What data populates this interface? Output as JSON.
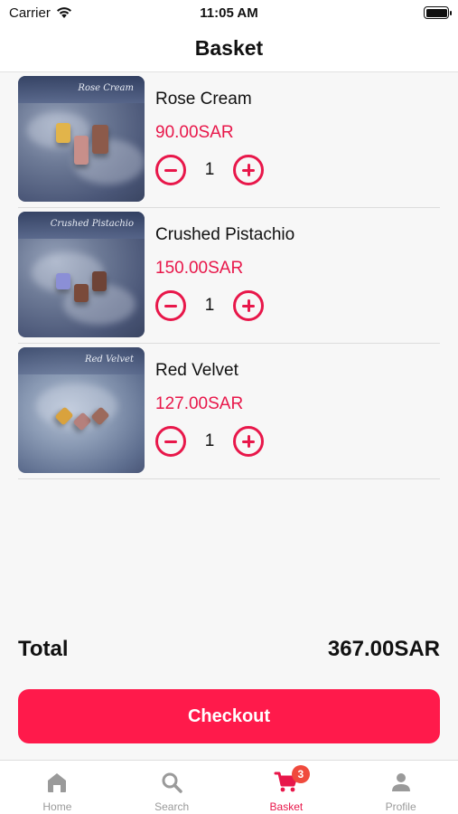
{
  "status_bar": {
    "carrier": "Carrier",
    "time": "11:05 AM"
  },
  "header": {
    "title": "Basket"
  },
  "items": [
    {
      "name": "Rose Cream",
      "price": "90.00SAR",
      "quantity": "1",
      "image_text": "Rose Cream"
    },
    {
      "name": "Crushed Pistachio",
      "price": "150.00SAR",
      "quantity": "1",
      "image_text": "Crushed Pistachio"
    },
    {
      "name": "Red Velvet",
      "price": "127.00SAR",
      "quantity": "1",
      "image_text": "Red Velvet"
    }
  ],
  "summary": {
    "total_label": "Total",
    "total_value": "367.00SAR"
  },
  "checkout": {
    "label": "Checkout"
  },
  "tabs": [
    {
      "label": "Home",
      "icon": "home-icon",
      "active": false
    },
    {
      "label": "Search",
      "icon": "search-icon",
      "active": false
    },
    {
      "label": "Basket",
      "icon": "cart-icon",
      "active": true,
      "badge": "3"
    },
    {
      "label": "Profile",
      "icon": "person-icon",
      "active": false
    }
  ],
  "colors": {
    "accent": "#e8174a",
    "button": "#ff1a4b",
    "badge": "#f04a3d"
  }
}
